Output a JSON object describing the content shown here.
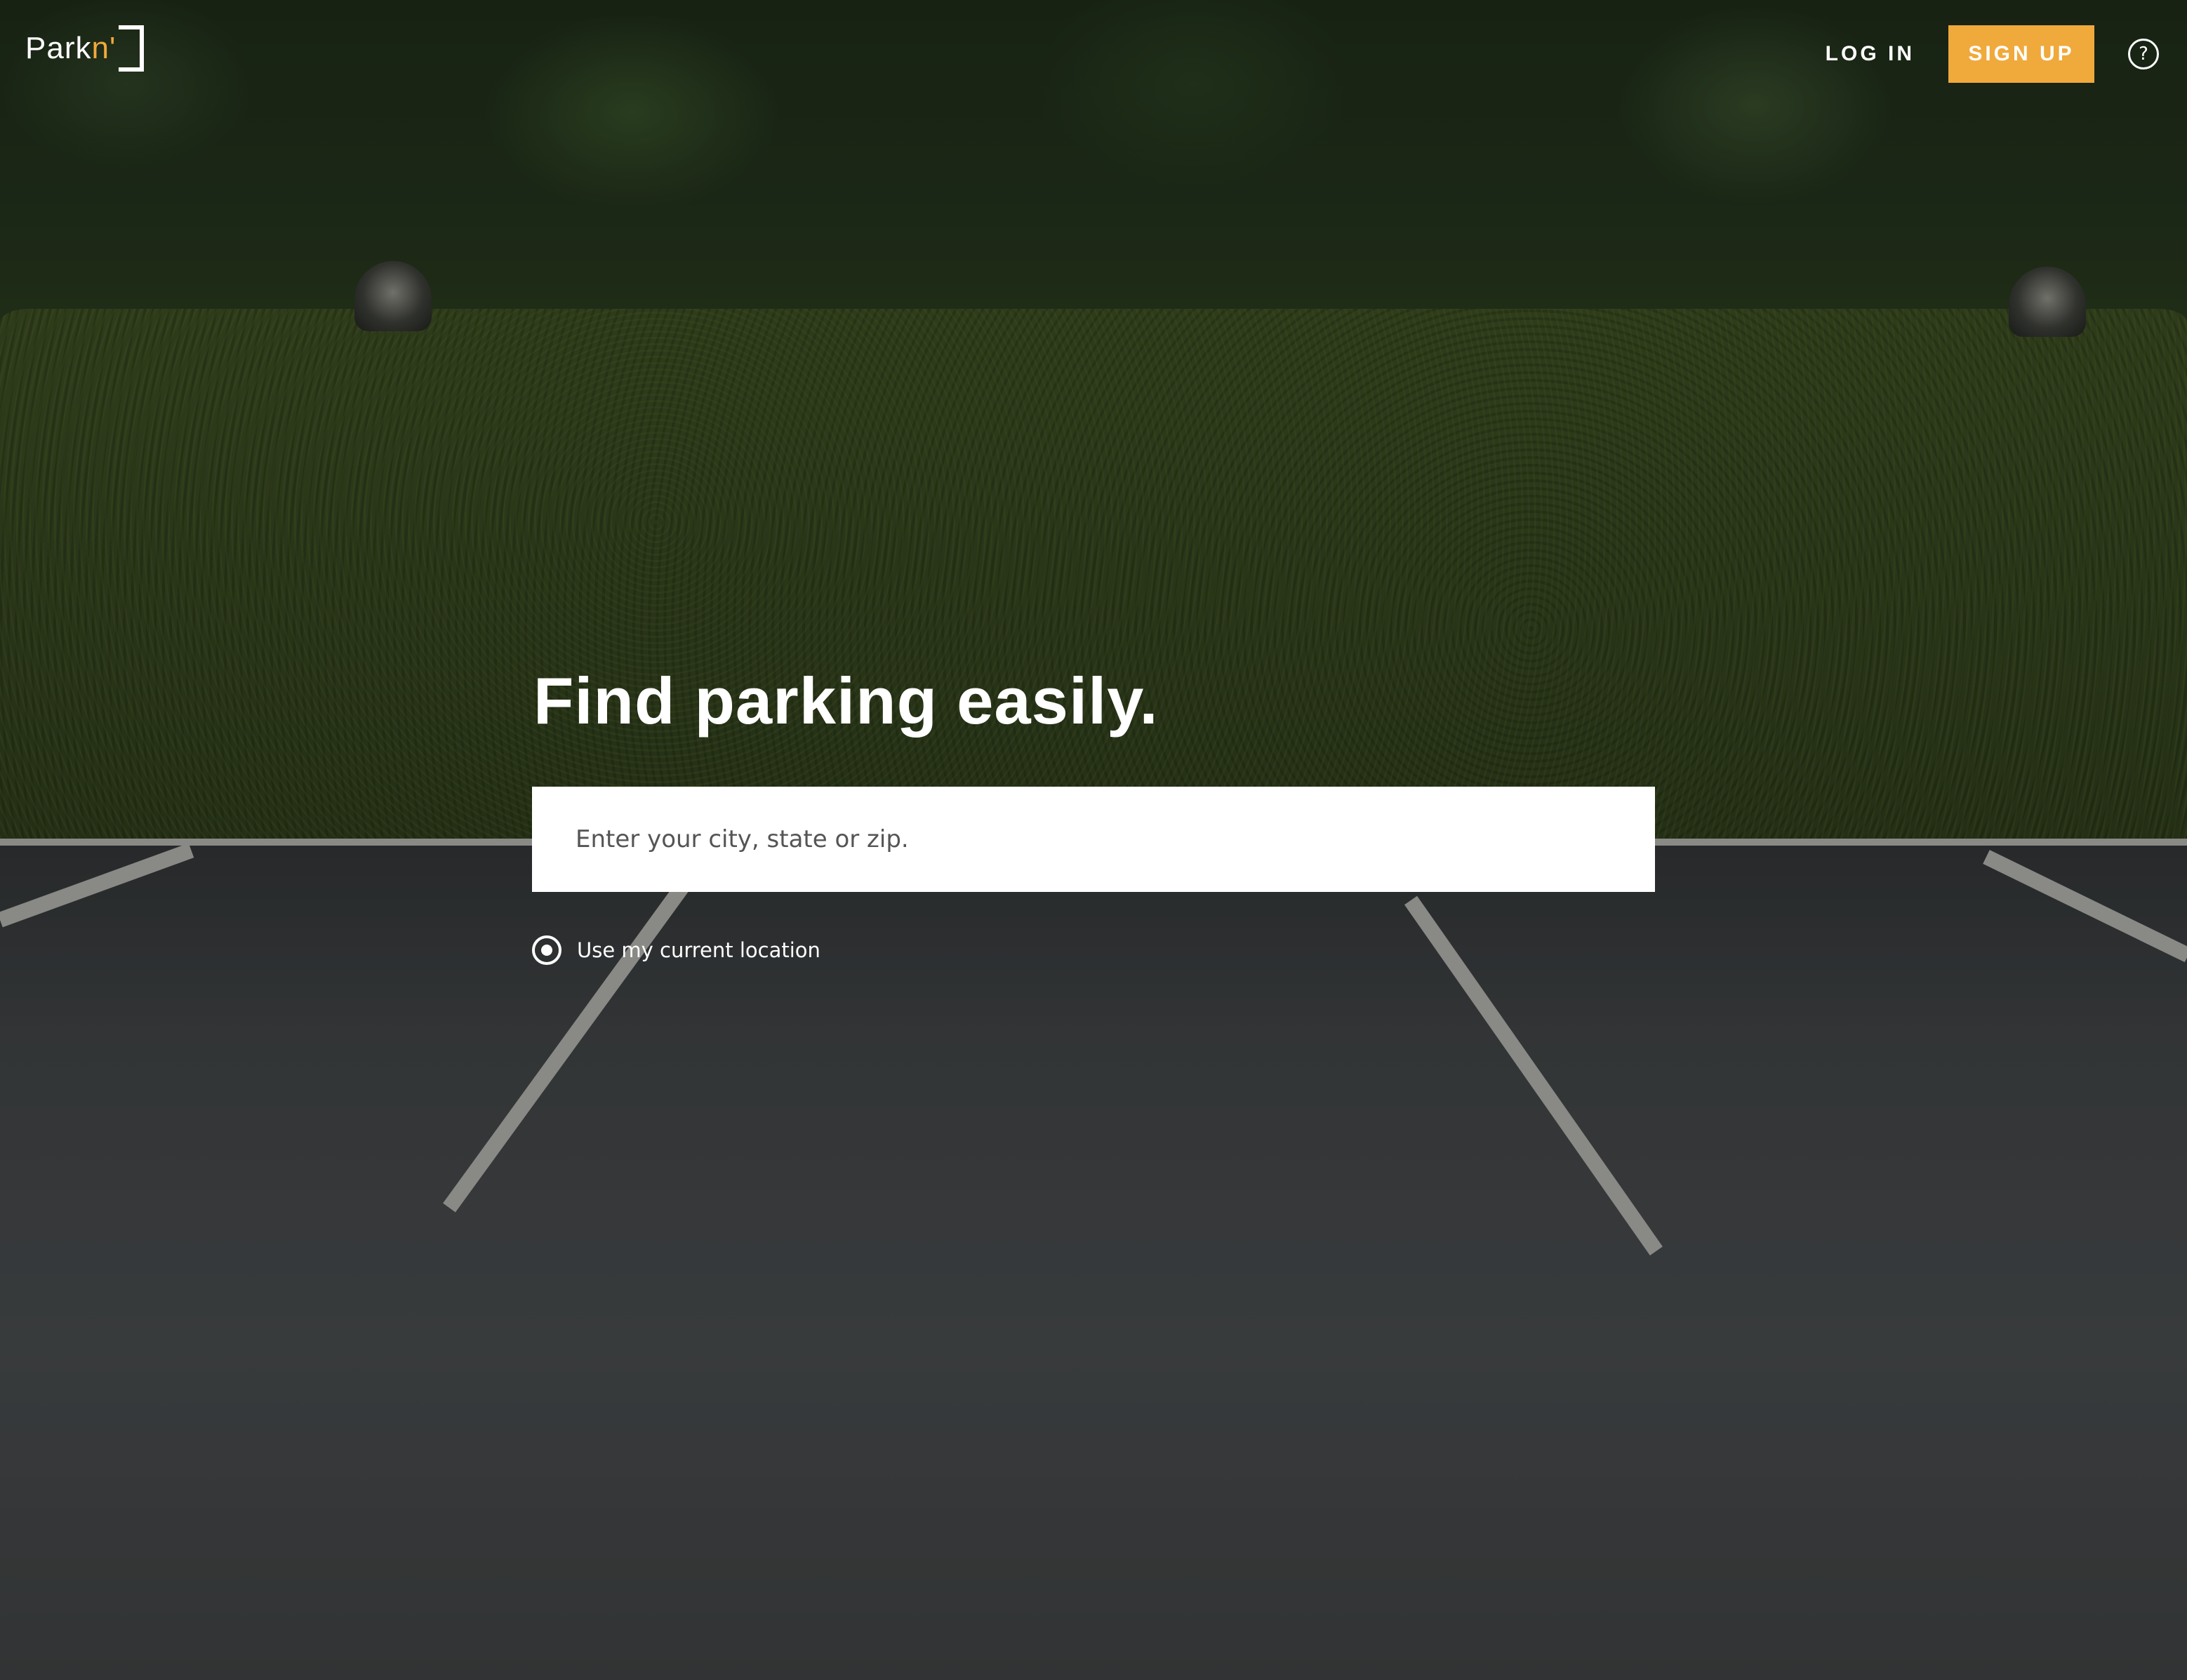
{
  "brand": {
    "name_main": "Park",
    "name_accent": "n'",
    "accent_color": "#f0a93b"
  },
  "nav": {
    "login_label": "LOG IN",
    "signup_label": "SIGN UP",
    "help_icon_glyph": "?"
  },
  "hero": {
    "title": "Find parking easily.",
    "search_placeholder": "Enter your city, state or zip.",
    "location_option_label": "Use my current location"
  },
  "icons": {
    "help": "question-circle-icon",
    "location": "radio-target-icon"
  }
}
